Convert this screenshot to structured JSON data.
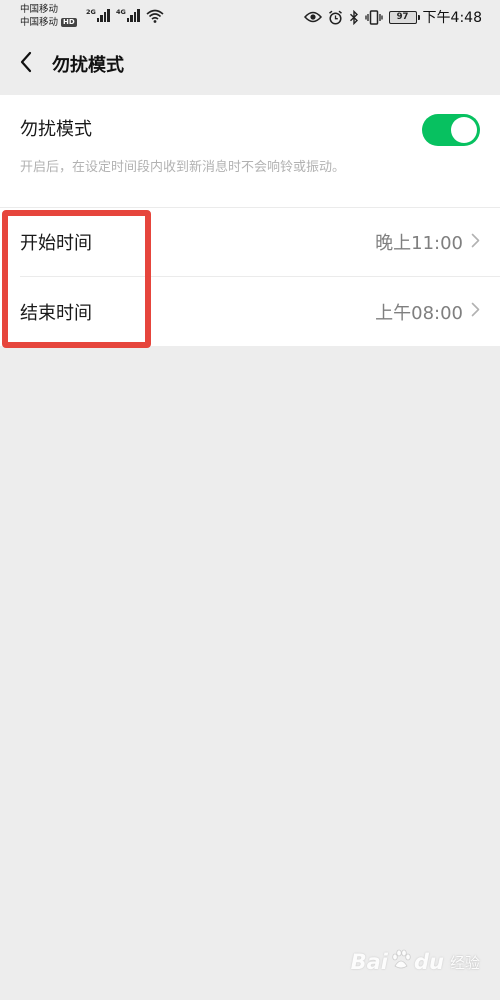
{
  "status_bar": {
    "carrier_1": "中国移动",
    "carrier_2": "中国移动",
    "hd_badge": "HD",
    "network_1": "2G",
    "network_2": "4G",
    "battery_level": "97",
    "time": "下午4:48",
    "icons": [
      "eye-icon",
      "alarm-icon",
      "bluetooth-icon",
      "vibrate-icon",
      "battery-icon"
    ]
  },
  "navbar": {
    "title": "勿扰模式",
    "back_icon": "chevron-left-icon"
  },
  "dnd": {
    "label": "勿扰模式",
    "description": "开启后，在设定时间段内收到新消息时不会响铃或振动。",
    "enabled": true,
    "accent_color": "#07c160"
  },
  "schedule": [
    {
      "label": "开始时间",
      "value": "晚上11:00"
    },
    {
      "label": "结束时间",
      "value": "上午08:00"
    }
  ],
  "annotation": {
    "highlight_color": "#e6453c"
  },
  "watermark": {
    "brand": "Bai",
    "brand_tail": "du",
    "sub": "经验"
  }
}
